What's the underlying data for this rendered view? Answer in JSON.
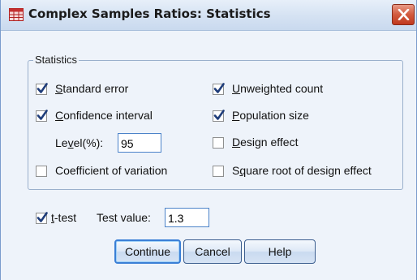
{
  "window": {
    "title": "Complex Samples Ratios: Statistics"
  },
  "icons": {
    "app": "spreadsheet-grid-icon",
    "close": "close-x-icon"
  },
  "colors": {
    "accent": "#3a7fd6",
    "close_button": "#c0391e",
    "checkmark": "#1f3d7a"
  },
  "statistics_group": {
    "legend": "Statistics",
    "standard_error": {
      "pre": "",
      "mnemonic": "S",
      "post": "tandard error",
      "checked": true
    },
    "confidence_interval": {
      "pre": "",
      "mnemonic": "C",
      "post": "onfidence interval",
      "checked": true
    },
    "level": {
      "pre": "Le",
      "mnemonic": "v",
      "post": "el(%):",
      "value": "95"
    },
    "coefficient_of_variation": {
      "pre": "Coefficient of variation",
      "mnemonic": "",
      "post": "",
      "checked": false
    },
    "unweighted_count": {
      "pre": "",
      "mnemonic": "U",
      "post": "nweighted count",
      "checked": true
    },
    "population_size": {
      "pre": "",
      "mnemonic": "P",
      "post": "opulation size",
      "checked": true
    },
    "design_effect": {
      "pre": "",
      "mnemonic": "D",
      "post": "esign effect",
      "checked": false
    },
    "sqrt_design_effect": {
      "pre": "S",
      "mnemonic": "q",
      "post": "uare root of design effect",
      "checked": false
    }
  },
  "t_test": {
    "pre": "",
    "mnemonic": "t",
    "post": "-test",
    "checked": true,
    "test_value_label": "Test value:",
    "test_value": "1.3"
  },
  "buttons": {
    "continue": "Continue",
    "cancel": "Cancel",
    "help": "Help"
  }
}
